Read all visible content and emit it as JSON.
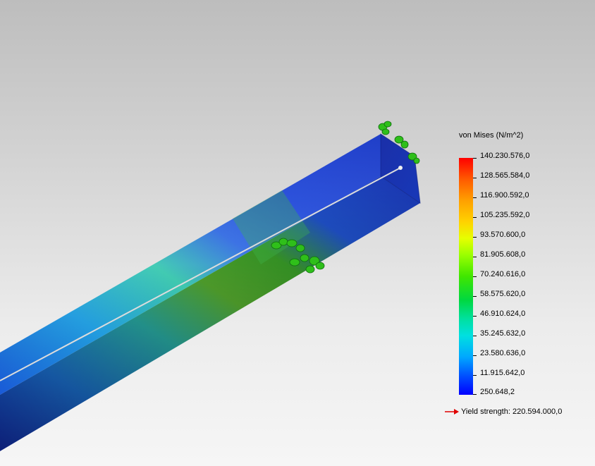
{
  "legend": {
    "title": "von Mises (N/m^2)",
    "labels": [
      "140.230.576,0",
      "128.565.584,0",
      "116.900.592,0",
      "105.235.592,0",
      "93.570.600,0",
      "81.905.608,0",
      "70.240.616,0",
      "58.575.620,0",
      "46.910.624,0",
      "35.245.632,0",
      "23.580.636,0",
      "11.915.642,0",
      "250.648,2"
    ],
    "yield_strength": "Yield strength: 220.594.000,0",
    "scale_colors": {
      "max": "#ff0000",
      "mid": "#40e600",
      "min": "#0000ff"
    }
  },
  "markers": {
    "yield_arrow_color": "#e00000",
    "fixture_color": "#2fbf1a"
  }
}
